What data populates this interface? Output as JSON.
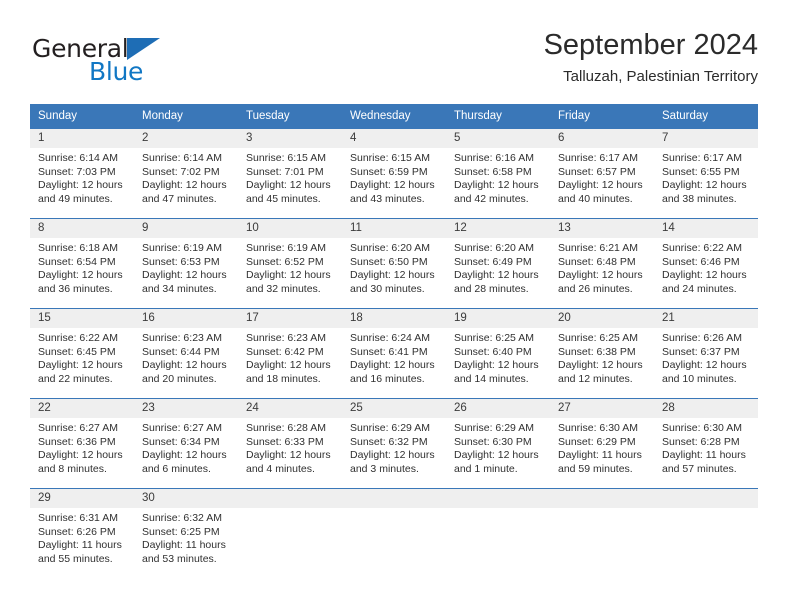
{
  "brand": {
    "name_part1": "General",
    "name_part2": "Blue",
    "logo_icon": "triangle-logo-icon"
  },
  "header": {
    "month_title": "September 2024",
    "location": "Talluzah, Palestinian Territory"
  },
  "colors": {
    "header_blue": "#3a77b8",
    "daynum_band_gray": "#efefef",
    "brand_blue": "#1177c4",
    "text": "#303030"
  },
  "weekday_headers": [
    "Sunday",
    "Monday",
    "Tuesday",
    "Wednesday",
    "Thursday",
    "Friday",
    "Saturday"
  ],
  "weeks": [
    {
      "days": [
        {
          "num": "1",
          "sunrise": "Sunrise: 6:14 AM",
          "sunset": "Sunset: 7:03 PM",
          "daylight_line1": "Daylight: 12 hours",
          "daylight_line2": "and 49 minutes."
        },
        {
          "num": "2",
          "sunrise": "Sunrise: 6:14 AM",
          "sunset": "Sunset: 7:02 PM",
          "daylight_line1": "Daylight: 12 hours",
          "daylight_line2": "and 47 minutes."
        },
        {
          "num": "3",
          "sunrise": "Sunrise: 6:15 AM",
          "sunset": "Sunset: 7:01 PM",
          "daylight_line1": "Daylight: 12 hours",
          "daylight_line2": "and 45 minutes."
        },
        {
          "num": "4",
          "sunrise": "Sunrise: 6:15 AM",
          "sunset": "Sunset: 6:59 PM",
          "daylight_line1": "Daylight: 12 hours",
          "daylight_line2": "and 43 minutes."
        },
        {
          "num": "5",
          "sunrise": "Sunrise: 6:16 AM",
          "sunset": "Sunset: 6:58 PM",
          "daylight_line1": "Daylight: 12 hours",
          "daylight_line2": "and 42 minutes."
        },
        {
          "num": "6",
          "sunrise": "Sunrise: 6:17 AM",
          "sunset": "Sunset: 6:57 PM",
          "daylight_line1": "Daylight: 12 hours",
          "daylight_line2": "and 40 minutes."
        },
        {
          "num": "7",
          "sunrise": "Sunrise: 6:17 AM",
          "sunset": "Sunset: 6:55 PM",
          "daylight_line1": "Daylight: 12 hours",
          "daylight_line2": "and 38 minutes."
        }
      ]
    },
    {
      "days": [
        {
          "num": "8",
          "sunrise": "Sunrise: 6:18 AM",
          "sunset": "Sunset: 6:54 PM",
          "daylight_line1": "Daylight: 12 hours",
          "daylight_line2": "and 36 minutes."
        },
        {
          "num": "9",
          "sunrise": "Sunrise: 6:19 AM",
          "sunset": "Sunset: 6:53 PM",
          "daylight_line1": "Daylight: 12 hours",
          "daylight_line2": "and 34 minutes."
        },
        {
          "num": "10",
          "sunrise": "Sunrise: 6:19 AM",
          "sunset": "Sunset: 6:52 PM",
          "daylight_line1": "Daylight: 12 hours",
          "daylight_line2": "and 32 minutes."
        },
        {
          "num": "11",
          "sunrise": "Sunrise: 6:20 AM",
          "sunset": "Sunset: 6:50 PM",
          "daylight_line1": "Daylight: 12 hours",
          "daylight_line2": "and 30 minutes."
        },
        {
          "num": "12",
          "sunrise": "Sunrise: 6:20 AM",
          "sunset": "Sunset: 6:49 PM",
          "daylight_line1": "Daylight: 12 hours",
          "daylight_line2": "and 28 minutes."
        },
        {
          "num": "13",
          "sunrise": "Sunrise: 6:21 AM",
          "sunset": "Sunset: 6:48 PM",
          "daylight_line1": "Daylight: 12 hours",
          "daylight_line2": "and 26 minutes."
        },
        {
          "num": "14",
          "sunrise": "Sunrise: 6:22 AM",
          "sunset": "Sunset: 6:46 PM",
          "daylight_line1": "Daylight: 12 hours",
          "daylight_line2": "and 24 minutes."
        }
      ]
    },
    {
      "days": [
        {
          "num": "15",
          "sunrise": "Sunrise: 6:22 AM",
          "sunset": "Sunset: 6:45 PM",
          "daylight_line1": "Daylight: 12 hours",
          "daylight_line2": "and 22 minutes."
        },
        {
          "num": "16",
          "sunrise": "Sunrise: 6:23 AM",
          "sunset": "Sunset: 6:44 PM",
          "daylight_line1": "Daylight: 12 hours",
          "daylight_line2": "and 20 minutes."
        },
        {
          "num": "17",
          "sunrise": "Sunrise: 6:23 AM",
          "sunset": "Sunset: 6:42 PM",
          "daylight_line1": "Daylight: 12 hours",
          "daylight_line2": "and 18 minutes."
        },
        {
          "num": "18",
          "sunrise": "Sunrise: 6:24 AM",
          "sunset": "Sunset: 6:41 PM",
          "daylight_line1": "Daylight: 12 hours",
          "daylight_line2": "and 16 minutes."
        },
        {
          "num": "19",
          "sunrise": "Sunrise: 6:25 AM",
          "sunset": "Sunset: 6:40 PM",
          "daylight_line1": "Daylight: 12 hours",
          "daylight_line2": "and 14 minutes."
        },
        {
          "num": "20",
          "sunrise": "Sunrise: 6:25 AM",
          "sunset": "Sunset: 6:38 PM",
          "daylight_line1": "Daylight: 12 hours",
          "daylight_line2": "and 12 minutes."
        },
        {
          "num": "21",
          "sunrise": "Sunrise: 6:26 AM",
          "sunset": "Sunset: 6:37 PM",
          "daylight_line1": "Daylight: 12 hours",
          "daylight_line2": "and 10 minutes."
        }
      ]
    },
    {
      "days": [
        {
          "num": "22",
          "sunrise": "Sunrise: 6:27 AM",
          "sunset": "Sunset: 6:36 PM",
          "daylight_line1": "Daylight: 12 hours",
          "daylight_line2": "and 8 minutes."
        },
        {
          "num": "23",
          "sunrise": "Sunrise: 6:27 AM",
          "sunset": "Sunset: 6:34 PM",
          "daylight_line1": "Daylight: 12 hours",
          "daylight_line2": "and 6 minutes."
        },
        {
          "num": "24",
          "sunrise": "Sunrise: 6:28 AM",
          "sunset": "Sunset: 6:33 PM",
          "daylight_line1": "Daylight: 12 hours",
          "daylight_line2": "and 4 minutes."
        },
        {
          "num": "25",
          "sunrise": "Sunrise: 6:29 AM",
          "sunset": "Sunset: 6:32 PM",
          "daylight_line1": "Daylight: 12 hours",
          "daylight_line2": "and 3 minutes."
        },
        {
          "num": "26",
          "sunrise": "Sunrise: 6:29 AM",
          "sunset": "Sunset: 6:30 PM",
          "daylight_line1": "Daylight: 12 hours",
          "daylight_line2": "and 1 minute."
        },
        {
          "num": "27",
          "sunrise": "Sunrise: 6:30 AM",
          "sunset": "Sunset: 6:29 PM",
          "daylight_line1": "Daylight: 11 hours",
          "daylight_line2": "and 59 minutes."
        },
        {
          "num": "28",
          "sunrise": "Sunrise: 6:30 AM",
          "sunset": "Sunset: 6:28 PM",
          "daylight_line1": "Daylight: 11 hours",
          "daylight_line2": "and 57 minutes."
        }
      ]
    },
    {
      "days": [
        {
          "num": "29",
          "sunrise": "Sunrise: 6:31 AM",
          "sunset": "Sunset: 6:26 PM",
          "daylight_line1": "Daylight: 11 hours",
          "daylight_line2": "and 55 minutes."
        },
        {
          "num": "30",
          "sunrise": "Sunrise: 6:32 AM",
          "sunset": "Sunset: 6:25 PM",
          "daylight_line1": "Daylight: 11 hours",
          "daylight_line2": "and 53 minutes."
        },
        {
          "num": "",
          "sunrise": "",
          "sunset": "",
          "daylight_line1": "",
          "daylight_line2": ""
        },
        {
          "num": "",
          "sunrise": "",
          "sunset": "",
          "daylight_line1": "",
          "daylight_line2": ""
        },
        {
          "num": "",
          "sunrise": "",
          "sunset": "",
          "daylight_line1": "",
          "daylight_line2": ""
        },
        {
          "num": "",
          "sunrise": "",
          "sunset": "",
          "daylight_line1": "",
          "daylight_line2": ""
        },
        {
          "num": "",
          "sunrise": "",
          "sunset": "",
          "daylight_line1": "",
          "daylight_line2": ""
        }
      ]
    }
  ]
}
